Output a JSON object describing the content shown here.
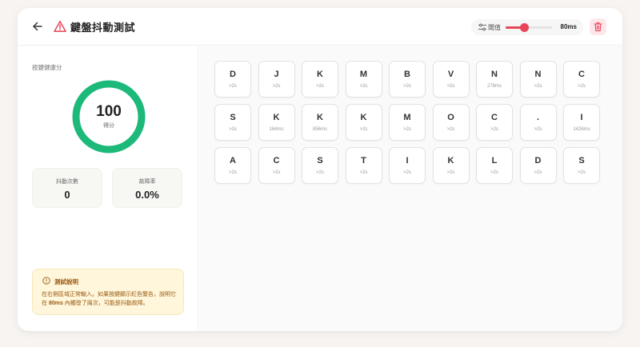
{
  "header": {
    "title": "鍵盤抖動測試",
    "threshold_label": "閾值",
    "threshold_value": "80ms",
    "threshold_level": 0.4
  },
  "sidebar": {
    "section_label": "按鍵健康分",
    "score": "100",
    "score_label": "得分",
    "score_fraction": 1.0,
    "stats": [
      {
        "label": "抖動次數",
        "value": "0"
      },
      {
        "label": "故障率",
        "value": "0.0%"
      }
    ],
    "info": {
      "title": "測試說明",
      "text_before": "在右側區域正常輸入。如果按鍵顯示紅色警告，說明它在 ",
      "text_highlight": "80ms",
      "text_after": " 內觸發了兩次，可能是抖動故障。"
    }
  },
  "keys": [
    {
      "key": "D",
      "time": ">2s"
    },
    {
      "key": "J",
      "time": ">2s"
    },
    {
      "key": "K",
      "time": ">2s"
    },
    {
      "key": "M",
      "time": ">2s"
    },
    {
      "key": "B",
      "time": ">2s"
    },
    {
      "key": "V",
      "time": ">2s"
    },
    {
      "key": "N",
      "time": "278ms"
    },
    {
      "key": "N",
      "time": ">2s"
    },
    {
      "key": "C",
      "time": ">2s"
    },
    {
      "key": "S",
      "time": ">2s"
    },
    {
      "key": "K",
      "time": "164ms"
    },
    {
      "key": "K",
      "time": "856ms"
    },
    {
      "key": "K",
      "time": ">2s"
    },
    {
      "key": "M",
      "time": ">2s"
    },
    {
      "key": "O",
      "time": ">2s"
    },
    {
      "key": "C",
      "time": ">2s"
    },
    {
      "key": ".",
      "time": ">2s"
    },
    {
      "key": "I",
      "time": "1426ms"
    },
    {
      "key": "A",
      "time": ">2s"
    },
    {
      "key": "C",
      "time": ">2s"
    },
    {
      "key": "S",
      "time": ">2s"
    },
    {
      "key": "T",
      "time": ">2s"
    },
    {
      "key": "I",
      "time": ">2s"
    },
    {
      "key": "K",
      "time": ">2s"
    },
    {
      "key": "L",
      "time": ">2s"
    },
    {
      "key": "D",
      "time": ">2s"
    },
    {
      "key": "S",
      "time": ">2s"
    }
  ],
  "colors": {
    "accent": "#e8455a",
    "healthy": "#1db97a",
    "warning_text": "#9a5a12",
    "warning_bg": "#fff6db"
  }
}
